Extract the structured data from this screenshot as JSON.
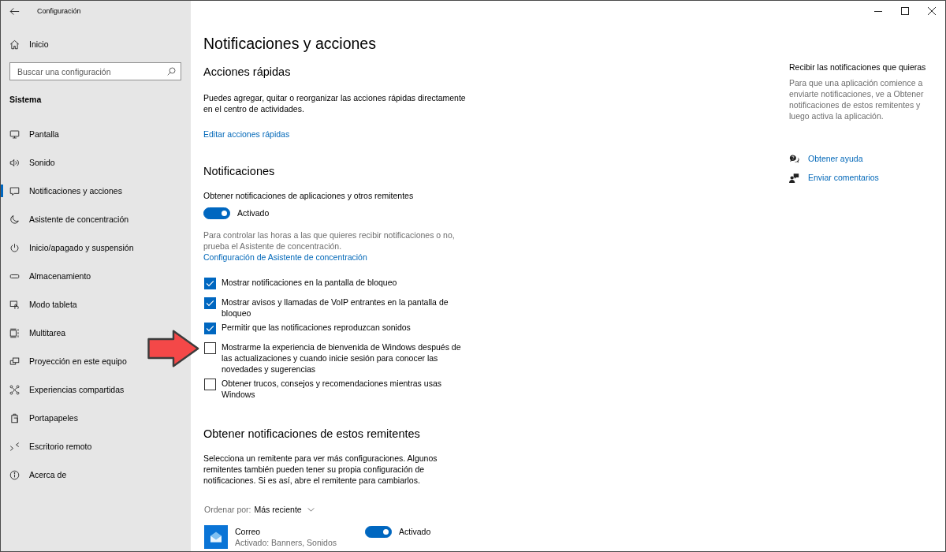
{
  "window": {
    "title": "Configuración"
  },
  "sidebar": {
    "home": {
      "label": "Inicio"
    },
    "search": {
      "placeholder": "Buscar una configuración"
    },
    "section": "Sistema",
    "items": [
      {
        "label": "Pantalla",
        "selected": false
      },
      {
        "label": "Sonido",
        "selected": false
      },
      {
        "label": "Notificaciones y acciones",
        "selected": true
      },
      {
        "label": "Asistente de concentración",
        "selected": false
      },
      {
        "label": "Inicio/apagado y suspensión",
        "selected": false
      },
      {
        "label": "Almacenamiento",
        "selected": false
      },
      {
        "label": "Modo tableta",
        "selected": false
      },
      {
        "label": "Multitarea",
        "selected": false
      },
      {
        "label": "Proyección en este equipo",
        "selected": false
      },
      {
        "label": "Experiencias compartidas",
        "selected": false
      },
      {
        "label": "Portapapeles",
        "selected": false
      },
      {
        "label": "Escritorio remoto",
        "selected": false
      },
      {
        "label": "Acerca de",
        "selected": false
      }
    ]
  },
  "page": {
    "title": "Notificaciones y acciones",
    "quick_actions": {
      "heading": "Acciones rápidas",
      "description": "Puedes agregar, quitar o reorganizar las acciones rápidas directamente en el centro de actividades.",
      "link": "Editar acciones rápidas"
    },
    "notifications": {
      "heading": "Notificaciones",
      "switch": {
        "label": "Obtener notificaciones de aplicaciones y otros remitentes",
        "on": true,
        "state_text": "Activado"
      },
      "hint": "Para controlar las horas a las que quieres recibir notificaciones o no, prueba el Asistente de concentración.",
      "link": "Configuración de Asistente de concentración",
      "options": [
        {
          "label": "Mostrar notificaciones en la pantalla de bloqueo",
          "checked": true,
          "annotated": false
        },
        {
          "label": "Mostrar avisos y llamadas de VoIP entrantes en la pantalla de bloqueo",
          "checked": true,
          "annotated": false
        },
        {
          "label": "Permitir que las notificaciones reproduzcan sonidos",
          "checked": true,
          "annotated": false
        },
        {
          "label": "Mostrarme la experiencia de bienvenida de Windows después de las actualizaciones y cuando inicie sesión para conocer las novedades y sugerencias",
          "checked": false,
          "annotated": true
        },
        {
          "label": "Obtener trucos, consejos y recomendaciones mientras usas Windows",
          "checked": false,
          "annotated": false
        }
      ]
    },
    "senders": {
      "heading": "Obtener notificaciones de estos remitentes",
      "description": "Selecciona un remitente para ver más configuraciones. Algunos remitentes también pueden tener su propia configuración de notificaciones. Si es así, abre el remitente para cambiarlos.",
      "sort": {
        "label": "Ordenar por:",
        "value": "Más reciente"
      },
      "apps": [
        {
          "name": "Correo",
          "status": "Activado: Banners, Sonidos",
          "on": true,
          "state_text": "Activado"
        }
      ]
    }
  },
  "aside": {
    "heading": "Recibir las notificaciones que quieras",
    "text": "Para que una aplicación comience a enviarte notificaciones, ve a Obtener notificaciones de estos remitentes y luego activa la aplicación.",
    "links": [
      {
        "label": "Obtener ayuda"
      },
      {
        "label": "Enviar comentarios"
      }
    ]
  }
}
